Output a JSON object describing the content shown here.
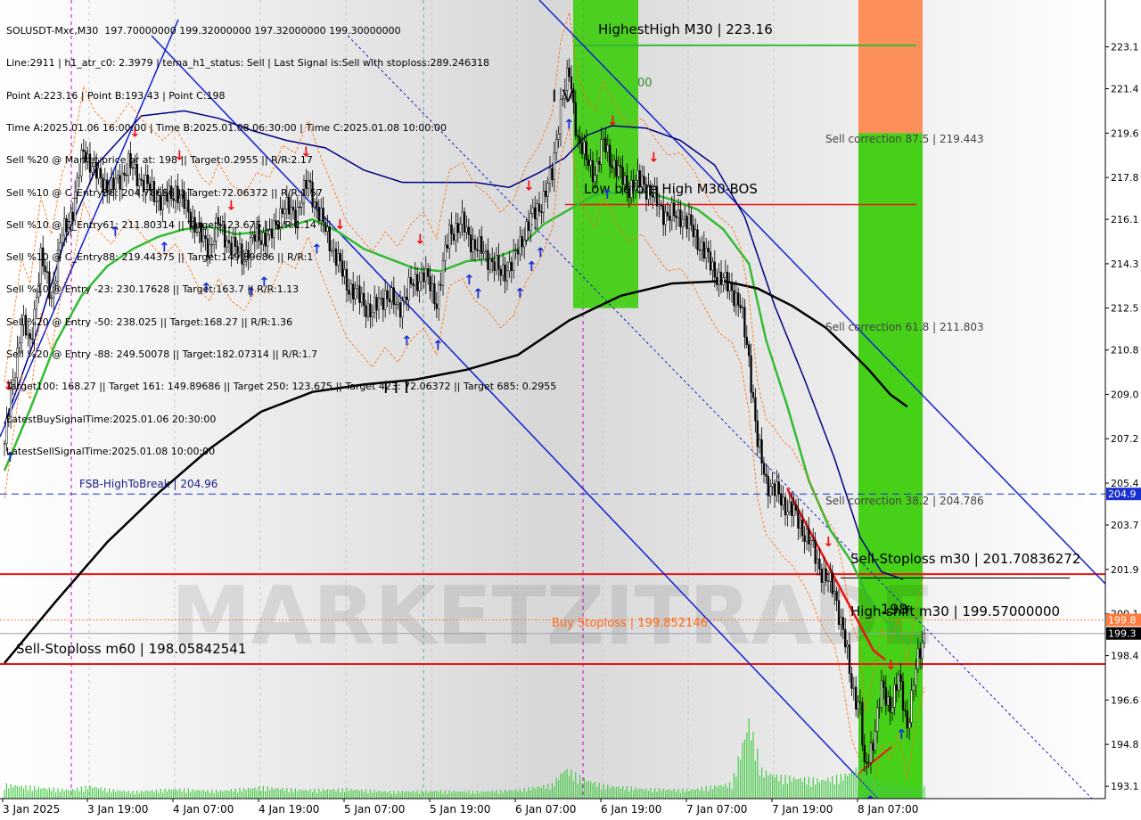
{
  "info_lines": [
    "SOLUSDT-Mxc,M30  197.70000000 199.32000000 197.32000000 199.30000000",
    "Line:2911 | h1_atr_c0: 2.3979 | tema_h1_status: Sell | Last Signal is:Sell with stoploss:289.246318",
    "Point A:223.16 | Point B:193.43 | Point C:198",
    "Time A:2025.01.06 16:00:00 | Time B:2025.01.08 06:30:00 | Time C:2025.01.08 10:00:00",
    "Sell %20 @ Market price or at: 198 || Target:0.2955 || R/R:2.17",
    "Sell %10 @ C_Entry38: 204.78686 || Target:72.06372 || R/R:1.57",
    "Sell %10 @ C_Entry61: 211.80314 || Target:123.675 || R/R:1.14",
    "Sell %10 @ C_Entry88: 219.44375 || Target:149.89686 || R/R:1",
    "Sell %10 @ Entry -23: 230.17628 || Target:163.7 || R/R:1.13",
    "Sell %20 @ Entry -50: 238.025 || Target:168.27 || R/R:1.36",
    "Sell %20 @ Entry -88: 249.50078 || Target:182.07314 || R/R:1.7",
    "Target100: 168.27 || Target 161: 149.89686 || Target 250: 123.675 || Target 423: 72.06372 || Target 685: 0.2955",
    "LatestBuySignalTime:2025.01.06 20:30:00",
    "LatestSellSignalTime:2025.01.08 10:00:00"
  ],
  "chart_data": {
    "type": "candlestick",
    "symbol": "SOLUSDT-Mxc",
    "timeframe": "M30",
    "ylim": [
      192.6,
      225.0
    ],
    "y_ticks": [
      "223.1",
      "221.4",
      "219.6",
      "217.8",
      "216.1",
      "214.3",
      "212.5",
      "210.8",
      "209.0",
      "207.2",
      "205.4",
      "203.7",
      "201.9",
      "200.1",
      "198.4",
      "196.6",
      "194.8",
      "193.1"
    ],
    "x_ticks": [
      "3 Jan 2025",
      "3 Jan 19:00",
      "4 Jan 07:00",
      "4 Jan 19:00",
      "5 Jan 07:00",
      "5 Jan 19:00",
      "6 Jan 07:00",
      "6 Jan 19:00",
      "7 Jan 07:00",
      "7 Jan 19:00",
      "8 Jan 07:00"
    ],
    "price_path": [
      [
        0,
        207.0
      ],
      [
        4,
        209.5
      ],
      [
        8,
        212.0
      ],
      [
        12,
        211.0
      ],
      [
        17,
        214.5
      ],
      [
        22,
        213.0
      ],
      [
        27,
        215.5
      ],
      [
        32,
        216.5
      ],
      [
        37,
        219.0
      ],
      [
        42,
        218.0
      ],
      [
        50,
        217.3
      ],
      [
        58,
        218.3
      ],
      [
        66,
        217.5
      ],
      [
        74,
        216.8
      ],
      [
        80,
        217.3
      ],
      [
        86,
        216.4
      ],
      [
        92,
        215.3
      ],
      [
        96,
        215.0
      ],
      [
        100,
        215.9
      ],
      [
        106,
        215.0
      ],
      [
        112,
        214.6
      ],
      [
        118,
        215.5
      ],
      [
        124,
        215.3
      ],
      [
        130,
        216.6
      ],
      [
        136,
        216.3
      ],
      [
        142,
        217.6
      ],
      [
        148,
        216.1
      ],
      [
        154,
        214.8
      ],
      [
        160,
        213.5
      ],
      [
        166,
        212.9
      ],
      [
        172,
        212.3
      ],
      [
        178,
        213.1
      ],
      [
        184,
        212.5
      ],
      [
        190,
        213.4
      ],
      [
        196,
        213.9
      ],
      [
        202,
        212.8
      ],
      [
        208,
        215.6
      ],
      [
        214,
        215.9
      ],
      [
        220,
        215.0
      ],
      [
        226,
        214.6
      ],
      [
        232,
        213.9
      ],
      [
        238,
        214.4
      ],
      [
        244,
        215.8
      ],
      [
        250,
        216.6
      ],
      [
        256,
        217.9
      ],
      [
        260,
        220.8
      ],
      [
        264,
        222.0
      ],
      [
        268,
        219.4
      ],
      [
        272,
        218.5
      ],
      [
        276,
        218.0
      ],
      [
        280,
        219.2
      ],
      [
        286,
        218.1
      ],
      [
        292,
        217.4
      ],
      [
        298,
        217.7
      ],
      [
        304,
        216.9
      ],
      [
        310,
        216.2
      ],
      [
        316,
        216.3
      ],
      [
        322,
        215.6
      ],
      [
        328,
        214.6
      ],
      [
        334,
        213.7
      ],
      [
        340,
        213.3
      ],
      [
        344,
        212.5
      ],
      [
        348,
        210.5
      ],
      [
        352,
        207.0
      ],
      [
        356,
        205.5
      ],
      [
        360,
        205.1
      ],
      [
        364,
        204.6
      ],
      [
        368,
        204.3
      ],
      [
        372,
        203.7
      ],
      [
        376,
        203.1
      ],
      [
        380,
        202.2
      ],
      [
        384,
        201.5
      ],
      [
        388,
        201.0
      ],
      [
        392,
        199.4
      ],
      [
        396,
        197.2
      ],
      [
        400,
        196.3
      ],
      [
        402,
        193.6
      ],
      [
        406,
        195.0
      ],
      [
        410,
        197.0
      ],
      [
        414,
        196.4
      ],
      [
        418,
        197.4
      ],
      [
        422,
        195.6
      ],
      [
        426,
        197.8
      ],
      [
        430,
        199.3
      ]
    ],
    "volume": [
      [
        0,
        1.6
      ],
      [
        10,
        1.4
      ],
      [
        20,
        1.2
      ],
      [
        30,
        1.0
      ],
      [
        40,
        1.4
      ],
      [
        50,
        1.0
      ],
      [
        60,
        0.8
      ],
      [
        80,
        1.1
      ],
      [
        100,
        0.9
      ],
      [
        120,
        1.3
      ],
      [
        140,
        1.0
      ],
      [
        160,
        1.1
      ],
      [
        180,
        0.8
      ],
      [
        200,
        0.9
      ],
      [
        220,
        0.8
      ],
      [
        240,
        1.0
      ],
      [
        256,
        1.6
      ],
      [
        262,
        3.4
      ],
      [
        270,
        2.3
      ],
      [
        280,
        1.5
      ],
      [
        300,
        1.1
      ],
      [
        320,
        1.0
      ],
      [
        340,
        1.7
      ],
      [
        348,
        8.9
      ],
      [
        354,
        3.2
      ],
      [
        362,
        2.5
      ],
      [
        372,
        2.3
      ],
      [
        382,
        2.1
      ],
      [
        392,
        2.6
      ],
      [
        398,
        3.3
      ],
      [
        402,
        5.7
      ],
      [
        406,
        2.3
      ],
      [
        414,
        1.8
      ],
      [
        422,
        1.4
      ]
    ],
    "line_green_ma": [
      [
        0,
        205.9
      ],
      [
        12,
        208.4
      ],
      [
        24,
        211.1
      ],
      [
        36,
        213.0
      ],
      [
        48,
        214.2
      ],
      [
        60,
        214.9
      ],
      [
        72,
        215.4
      ],
      [
        84,
        215.7
      ],
      [
        96,
        215.8
      ],
      [
        108,
        215.5
      ],
      [
        120,
        215.6
      ],
      [
        132,
        215.8
      ],
      [
        144,
        216.1
      ],
      [
        156,
        215.6
      ],
      [
        168,
        214.9
      ],
      [
        180,
        214.5
      ],
      [
        192,
        214.1
      ],
      [
        204,
        214.0
      ],
      [
        216,
        214.4
      ],
      [
        228,
        214.5
      ],
      [
        240,
        214.9
      ],
      [
        252,
        215.9
      ],
      [
        264,
        216.5
      ],
      [
        276,
        217.1
      ],
      [
        288,
        217.2
      ],
      [
        300,
        217.2
      ],
      [
        312,
        216.9
      ],
      [
        324,
        216.5
      ],
      [
        336,
        215.7
      ],
      [
        348,
        214.3
      ],
      [
        356,
        211.2
      ],
      [
        366,
        208.5
      ],
      [
        376,
        205.5
      ],
      [
        386,
        203.5
      ],
      [
        396,
        202.2
      ],
      [
        404,
        200.7
      ],
      [
        412,
        199.8
      ],
      [
        422,
        198.9
      ],
      [
        430,
        199.0
      ]
    ],
    "line_black_ma": [
      [
        0,
        198.1
      ],
      [
        24,
        200.6
      ],
      [
        48,
        203.0
      ],
      [
        72,
        205.0
      ],
      [
        96,
        206.8
      ],
      [
        120,
        208.3
      ],
      [
        144,
        209.1
      ],
      [
        168,
        209.4
      ],
      [
        192,
        209.6
      ],
      [
        216,
        210.0
      ],
      [
        240,
        210.6
      ],
      [
        264,
        212.0
      ],
      [
        288,
        213.0
      ],
      [
        312,
        213.5
      ],
      [
        336,
        213.6
      ],
      [
        352,
        213.3
      ],
      [
        368,
        212.6
      ],
      [
        384,
        211.7
      ],
      [
        396,
        210.7
      ],
      [
        404,
        210.0
      ],
      [
        414,
        209.0
      ],
      [
        422,
        208.5
      ]
    ],
    "line_navy_env": [
      [
        0,
        207.8
      ],
      [
        14,
        211.2
      ],
      [
        28,
        215.2
      ],
      [
        44,
        218.4
      ],
      [
        64,
        220.3
      ],
      [
        84,
        220.5
      ],
      [
        100,
        220.2
      ],
      [
        116,
        219.7
      ],
      [
        132,
        219.3
      ],
      [
        150,
        219.0
      ],
      [
        168,
        218.1
      ],
      [
        186,
        217.6
      ],
      [
        204,
        217.6
      ],
      [
        220,
        217.6
      ],
      [
        236,
        217.4
      ],
      [
        250,
        218.0
      ],
      [
        262,
        218.6
      ],
      [
        272,
        219.5
      ],
      [
        284,
        219.9
      ],
      [
        300,
        219.8
      ],
      [
        316,
        219.3
      ],
      [
        332,
        218.3
      ],
      [
        346,
        216.2
      ],
      [
        360,
        212.6
      ],
      [
        374,
        209.6
      ],
      [
        388,
        206.4
      ],
      [
        400,
        203.2
      ],
      [
        410,
        201.8
      ],
      [
        420,
        201.5
      ]
    ],
    "overlays": {
      "highest_high": "HighestHigh    M30 | 223.16",
      "low_before_high": "Low before High    M30-BOS",
      "fsb": "FSB-HighToBreak | 204.96",
      "sell_corr_875": "Sell correction 87.5 | 219.443",
      "sell_corr_618": "Sell correction 61.8 | 211.803",
      "sell_corr_382": "Sell correction 38.2 | 204.786",
      "sell_stoploss_m30": "Sell-Stoploss m30 | 201.70836272",
      "high_shift": "High-shift m30 | 199.57000000",
      "buy_stoploss": "Buy Stoploss | 199.852146",
      "sell_stoploss_m60": "Sell-Stoploss m60 | 198.05842541",
      "wave_iii": "I I I",
      "wave_iv": "I V",
      "wave_v_label": "V",
      "point_198": "198",
      "label_00": "00"
    },
    "price_tags": {
      "tag_2049": "204.9",
      "tag_1998": "199.8",
      "tag_1993": "199.3"
    },
    "watermark": "MARKETZITRADE"
  },
  "colors": {
    "green_zone": "#33cc00",
    "orange_zone": "#ff7f3f",
    "sell_red": "#ee1111",
    "channel_blue": "#1020d0",
    "ma_green": "#33bb33",
    "dark_blue": "#000080",
    "black_ma": "#000000"
  }
}
